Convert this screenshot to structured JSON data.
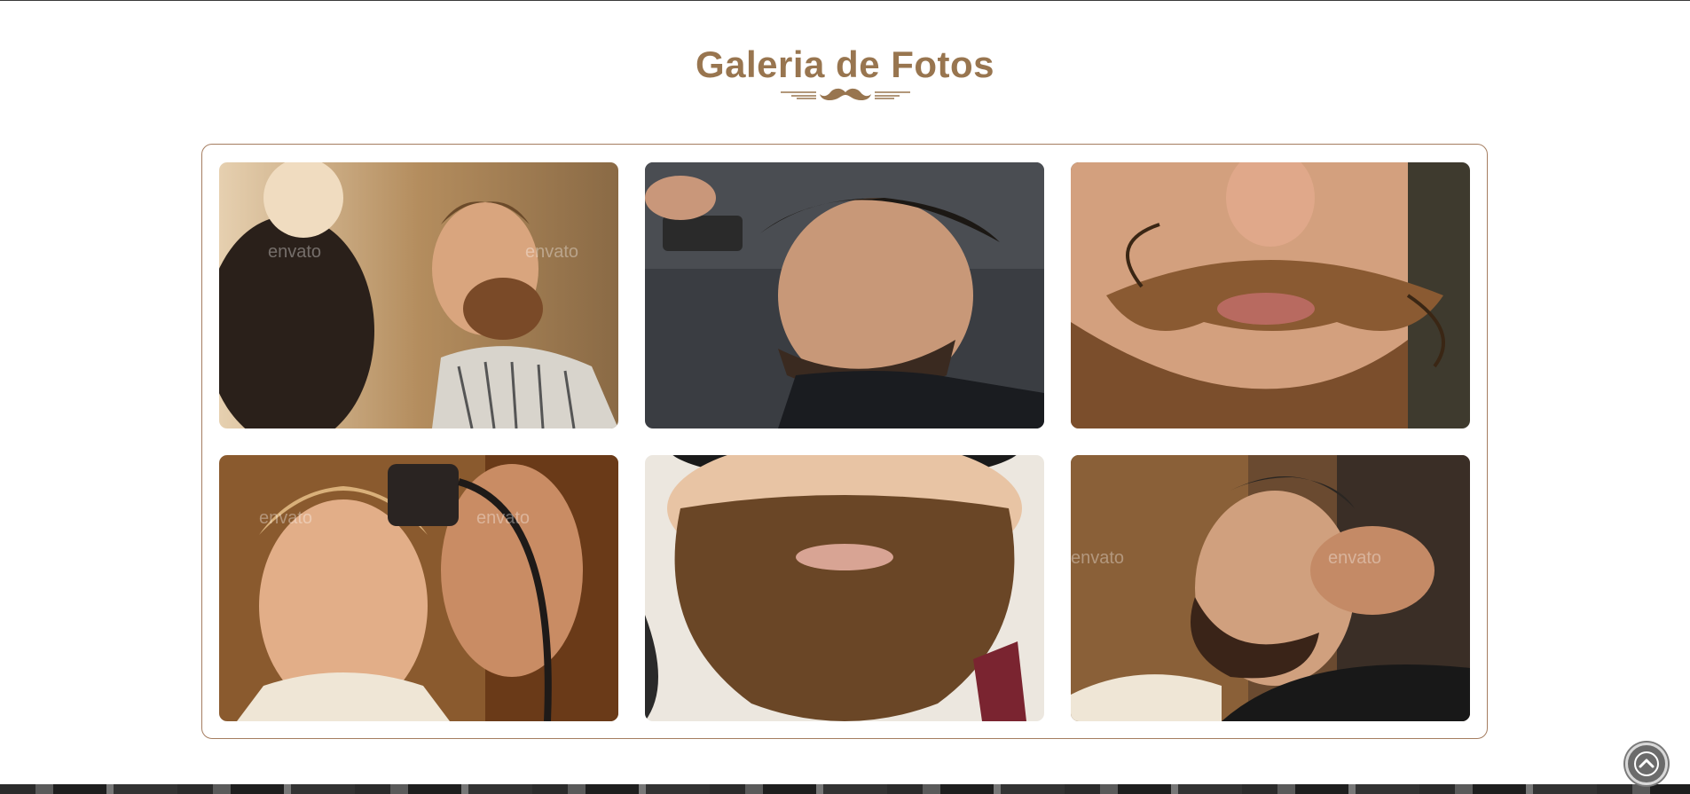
{
  "section": {
    "title": "Galeria de Fotos",
    "divider_icon": "mustache-icon",
    "accent_color": "#98754f",
    "border_color": "#a57d60"
  },
  "gallery": {
    "photos": [
      {
        "name": "barber-woman-trimming-beard",
        "watermarks": [
          "envato",
          "envato"
        ]
      },
      {
        "name": "man-fade-haircut-profile",
        "watermarks": []
      },
      {
        "name": "curled-mustache-closeup",
        "watermarks": []
      },
      {
        "name": "boy-haircut-clippers",
        "watermarks": [
          "envato",
          "envato"
        ]
      },
      {
        "name": "long-beard-closeup",
        "watermarks": []
      },
      {
        "name": "man-hair-wash-salon",
        "watermarks": [
          "envato",
          "envato"
        ]
      }
    ]
  },
  "controls": {
    "scroll_top_icon": "chevron-up-icon"
  }
}
